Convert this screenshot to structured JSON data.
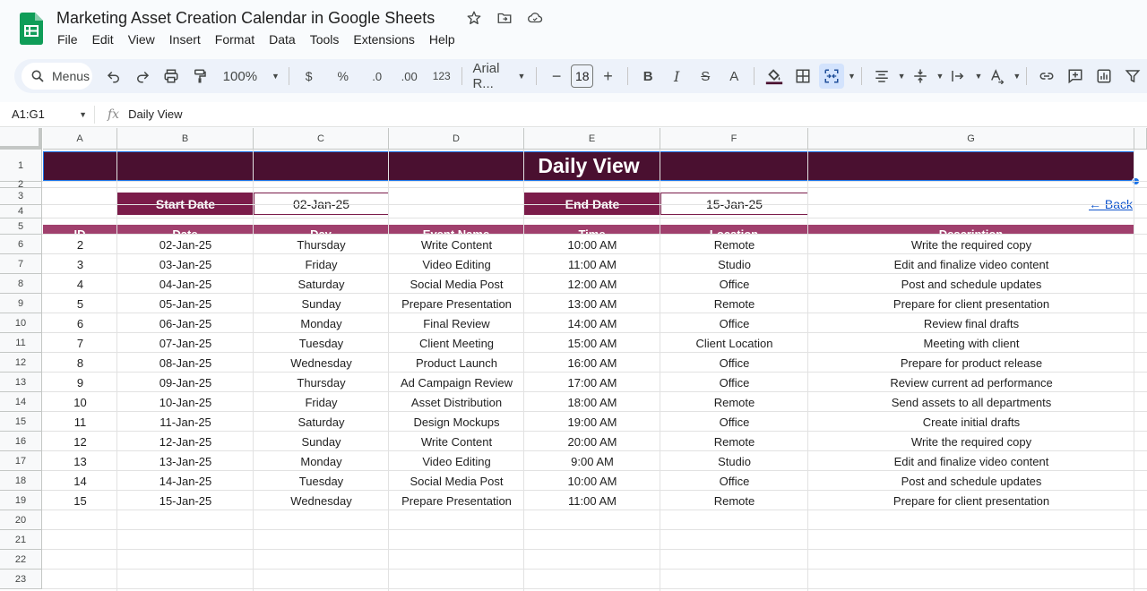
{
  "app": {
    "title": "Marketing Asset Creation Calendar in Google Sheets",
    "menu": [
      "File",
      "Edit",
      "View",
      "Insert",
      "Format",
      "Data",
      "Tools",
      "Extensions",
      "Help"
    ]
  },
  "toolbar": {
    "search_label": "Menus",
    "zoom": "100%",
    "currency": "$",
    "percent": "%",
    "dec_decrease": ".0",
    "dec_increase": ".00",
    "number_format": "123",
    "font": "Arial R...",
    "font_size": "18",
    "minus": "−",
    "plus": "+",
    "bold": "B",
    "italic": "I",
    "strike": "S",
    "text_color": "A"
  },
  "formula_bar": {
    "name_box": "A1:G1",
    "fx": "fx",
    "value": "Daily View"
  },
  "columns": [
    "A",
    "B",
    "C",
    "D",
    "E",
    "F",
    "G"
  ],
  "rows": [
    "1",
    "2",
    "3",
    "4",
    "5",
    "6",
    "7",
    "8",
    "9",
    "10",
    "11",
    "12",
    "13",
    "14",
    "15",
    "16",
    "17",
    "18",
    "19",
    "20",
    "21",
    "22",
    "23"
  ],
  "sheet": {
    "banner": "Daily View",
    "start_label": "Start Date",
    "start_value": "02-Jan-25",
    "end_label": "End Date",
    "end_value": "15-Jan-25",
    "back_link": "← Back",
    "headers": [
      "ID",
      "Date",
      "Day",
      "Event Name",
      "Time",
      "Location",
      "Description"
    ],
    "records": [
      [
        "2",
        "02-Jan-25",
        "Thursday",
        "Write Content",
        "10:00 AM",
        "Remote",
        "Write the required copy"
      ],
      [
        "3",
        "03-Jan-25",
        "Friday",
        "Video Editing",
        "11:00 AM",
        "Studio",
        "Edit and finalize video content"
      ],
      [
        "4",
        "04-Jan-25",
        "Saturday",
        "Social Media Post",
        "12:00 AM",
        "Office",
        "Post and schedule updates"
      ],
      [
        "5",
        "05-Jan-25",
        "Sunday",
        "Prepare Presentation",
        "13:00 AM",
        "Remote",
        "Prepare for client presentation"
      ],
      [
        "6",
        "06-Jan-25",
        "Monday",
        "Final Review",
        "14:00 AM",
        "Office",
        "Review final drafts"
      ],
      [
        "7",
        "07-Jan-25",
        "Tuesday",
        "Client Meeting",
        "15:00 AM",
        "Client Location",
        "Meeting with client"
      ],
      [
        "8",
        "08-Jan-25",
        "Wednesday",
        "Product Launch",
        "16:00 AM",
        "Office",
        "Prepare for product release"
      ],
      [
        "9",
        "09-Jan-25",
        "Thursday",
        "Ad Campaign Review",
        "17:00 AM",
        "Office",
        "Review current ad performance"
      ],
      [
        "10",
        "10-Jan-25",
        "Friday",
        "Asset Distribution",
        "18:00 AM",
        "Remote",
        "Send assets to all departments"
      ],
      [
        "11",
        "11-Jan-25",
        "Saturday",
        "Design Mockups",
        "19:00 AM",
        "Office",
        "Create initial drafts"
      ],
      [
        "12",
        "12-Jan-25",
        "Sunday",
        "Write Content",
        "20:00 AM",
        "Remote",
        "Write the required copy"
      ],
      [
        "13",
        "13-Jan-25",
        "Monday",
        "Video Editing",
        "9:00 AM",
        "Studio",
        "Edit and finalize video content"
      ],
      [
        "14",
        "14-Jan-25",
        "Tuesday",
        "Social Media Post",
        "10:00 AM",
        "Office",
        "Post and schedule updates"
      ],
      [
        "15",
        "15-Jan-25",
        "Wednesday",
        "Prepare Presentation",
        "11:00 AM",
        "Remote",
        "Prepare for client presentation"
      ]
    ]
  },
  "colors": {
    "banner": "#4a1030",
    "date_label": "#7b1c4a",
    "table_header": "#a0406d",
    "link": "#1155cc",
    "selection": "#1a73e8"
  }
}
